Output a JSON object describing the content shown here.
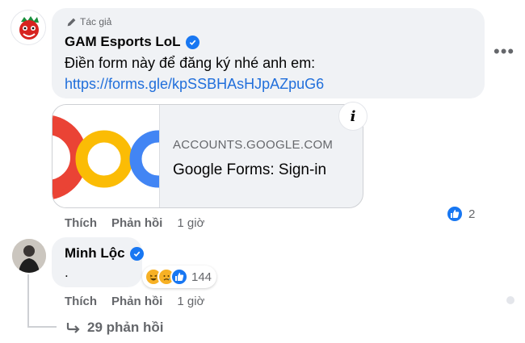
{
  "comment1": {
    "author_tag": "Tác giả",
    "author": "GAM Esports LoL",
    "text": "Điền form này để đăng ký nhé anh em:",
    "link": "https://forms.gle/kpSSBHAsHJpAZpuG6",
    "more_icon": "more-horizontal-icon"
  },
  "preview": {
    "domain": "ACCOUNTS.GOOGLE.COM",
    "title": "Google Forms: Sign-in",
    "info_label": "i"
  },
  "actions1": {
    "like": "Thích",
    "reply": "Phản hồi",
    "time": "1 giờ",
    "reaction_count": "2"
  },
  "comment2": {
    "author": "Minh Lộc",
    "text": "."
  },
  "actions2": {
    "like": "Thích",
    "reply": "Phản hồi",
    "time": "1 giờ",
    "reaction_count": "144"
  },
  "replies": {
    "label": "29 phản hồi"
  },
  "colors": {
    "bubble": "#f0f2f5",
    "link": "#216fdb",
    "secondary_text": "#65676b",
    "verified": "#1877f2"
  }
}
